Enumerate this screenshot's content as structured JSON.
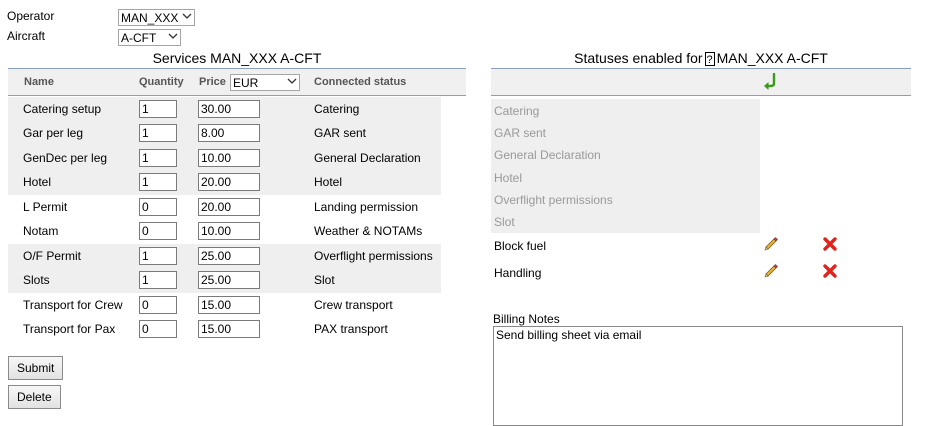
{
  "form": {
    "operator_label": "Operator",
    "operator_value": "MAN_XXX",
    "aircraft_label": "Aircraft",
    "aircraft_value": "A-CFT"
  },
  "services": {
    "title": "Services MAN_XXX A-CFT",
    "col_name": "Name",
    "col_quantity": "Quantity",
    "col_price": "Price",
    "currency": "EUR",
    "col_status": "Connected status",
    "rows": [
      {
        "name": "Catering setup",
        "qty": "1",
        "price": "30.00",
        "status": "Catering"
      },
      {
        "name": "Gar per leg",
        "qty": "1",
        "price": "8.00",
        "status": "GAR sent"
      },
      {
        "name": "GenDec per leg",
        "qty": "1",
        "price": "10.00",
        "status": "General Declaration"
      },
      {
        "name": "Hotel",
        "qty": "1",
        "price": "20.00",
        "status": "Hotel"
      },
      {
        "name": "L Permit",
        "qty": "0",
        "price": "20.00",
        "status": "Landing permission"
      },
      {
        "name": "Notam",
        "qty": "0",
        "price": "10.00",
        "status": "Weather & NOTAMs"
      },
      {
        "name": "O/F Permit",
        "qty": "1",
        "price": "25.00",
        "status": "Overflight permissions"
      },
      {
        "name": "Slots",
        "qty": "1",
        "price": "25.00",
        "status": "Slot"
      },
      {
        "name": "Transport for Crew",
        "qty": "0",
        "price": "15.00",
        "status": "Crew transport"
      },
      {
        "name": "Transport for Pax",
        "qty": "0",
        "price": "15.00",
        "status": "PAX transport"
      }
    ],
    "submit_label": "Submit",
    "delete_label": "Delete"
  },
  "statuses": {
    "title_prefix": "Statuses enabled for",
    "help": "?",
    "title_suffix": "MAN_XXX A-CFT",
    "disabled": [
      "Catering",
      "GAR sent",
      "General Declaration",
      "Hotel",
      "Overflight permissions",
      "Slot"
    ],
    "enabled": [
      "Block fuel",
      "Handling"
    ]
  },
  "billing": {
    "label": "Billing Notes",
    "text": "Send billing sheet via email"
  },
  "colors": {
    "accent_green": "#3a9a1a",
    "delete_red": "#e0241c",
    "row_shade": "#efefef",
    "disabled_text": "#999999"
  }
}
